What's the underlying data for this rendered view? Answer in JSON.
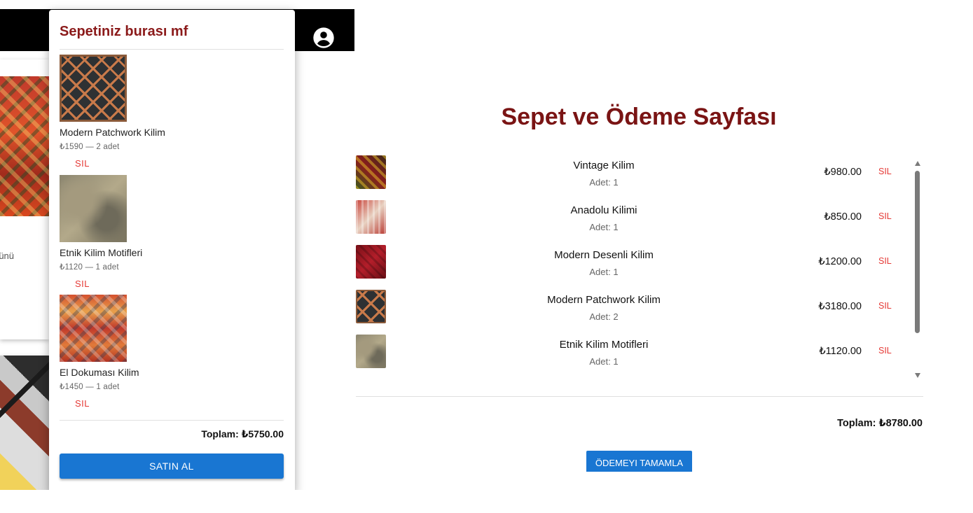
{
  "background_page": {
    "product_card_text": "rünü"
  },
  "cart": {
    "title": "Sepetiniz burası mf",
    "items": [
      {
        "name": "Modern Patchwork Kilim",
        "meta": "₺1590 — 2 adet",
        "remove_label": "SIL"
      },
      {
        "name": "Etnik Kilim Motifleri",
        "meta": "₺1120 — 1 adet",
        "remove_label": "SIL"
      },
      {
        "name": "El Dokuması Kilim",
        "meta": "₺1450 — 1 adet",
        "remove_label": "SIL"
      }
    ],
    "total": "Toplam: ₺5750.00",
    "buy_label": "SATIN AL"
  },
  "checkout": {
    "title": "Sepet ve Ödeme Sayfası",
    "items": [
      {
        "name": "Vintage Kilim",
        "qty": "Adet: 1",
        "price": "₺980.00",
        "remove_label": "SIL"
      },
      {
        "name": "Anadolu Kilimi",
        "qty": "Adet: 1",
        "price": "₺850.00",
        "remove_label": "SIL"
      },
      {
        "name": "Modern Desenli Kilim",
        "qty": "Adet: 1",
        "price": "₺1200.00",
        "remove_label": "SIL"
      },
      {
        "name": "Modern Patchwork Kilim",
        "qty": "Adet: 2",
        "price": "₺3180.00",
        "remove_label": "SIL"
      },
      {
        "name": "Etnik Kilim Motifleri",
        "qty": "Adet: 1",
        "price": "₺1120.00",
        "remove_label": "SIL"
      }
    ],
    "total": "Toplam: ₺8780.00",
    "pay_label": "ÖDEMEYI TAMAMLA"
  },
  "colors": {
    "title_red": "#7a1414",
    "remove_red": "#e53935",
    "button_blue": "#1976d2",
    "appbar_black": "#000000"
  },
  "icons": {
    "account": "account-circle-icon"
  }
}
